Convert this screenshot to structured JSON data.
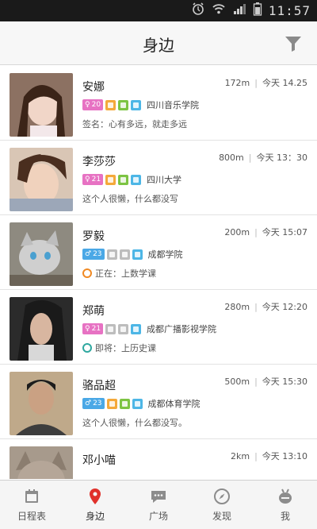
{
  "status_bar": {
    "time": "11:57"
  },
  "header": {
    "title": "身边"
  },
  "people": [
    {
      "name": "安娜",
      "gender": "female",
      "age": "20",
      "distance": "172m",
      "time": "今天 14.25",
      "school": "四川音乐学院",
      "tag_colors": [
        "orange",
        "green",
        "blue"
      ],
      "status_type": "text",
      "status": "签名：心有多远，就走多远"
    },
    {
      "name": "李莎莎",
      "gender": "female",
      "age": "21",
      "distance": "800m",
      "time": "今天 13：30",
      "school": "四川大学",
      "tag_colors": [
        "orange",
        "green",
        "blue"
      ],
      "status_type": "text",
      "status": "这个人很懒，什么都没写"
    },
    {
      "name": "罗毅",
      "gender": "male",
      "age": "23",
      "distance": "200m",
      "time": "今天 15:07",
      "school": "成都学院",
      "tag_colors": [
        "grey",
        "grey",
        "blue"
      ],
      "status_type": "now",
      "status": "正在：上数学课"
    },
    {
      "name": "郑萌",
      "gender": "female",
      "age": "21",
      "distance": "280m",
      "time": "今天 12:20",
      "school": "成都广播影视学院",
      "tag_colors": [
        "grey",
        "grey",
        "blue"
      ],
      "status_type": "upcoming",
      "status": "即将：上历史课"
    },
    {
      "name": "骆品超",
      "gender": "male",
      "age": "23",
      "distance": "500m",
      "time": "今天 15:30",
      "school": "成都体育学院",
      "tag_colors": [
        "orange",
        "green",
        "blue"
      ],
      "status_type": "text",
      "status": "这个人很懒，什么都没写。"
    },
    {
      "name": "邓小喵",
      "gender": "female",
      "age": "",
      "distance": "2km",
      "time": "今天 13:10",
      "school": "",
      "tag_colors": [],
      "status_type": "text",
      "status": ""
    }
  ],
  "tabs": [
    {
      "label": "日程表",
      "icon": "calendar-icon"
    },
    {
      "label": "身边",
      "icon": "location-pin-icon"
    },
    {
      "label": "广场",
      "icon": "chat-bubble-icon"
    },
    {
      "label": "发现",
      "icon": "compass-icon"
    },
    {
      "label": "我",
      "icon": "profile-icon"
    }
  ],
  "colors": {
    "active_tab": "#e0312b",
    "female": "#e772c3",
    "male": "#4aa8e6"
  }
}
